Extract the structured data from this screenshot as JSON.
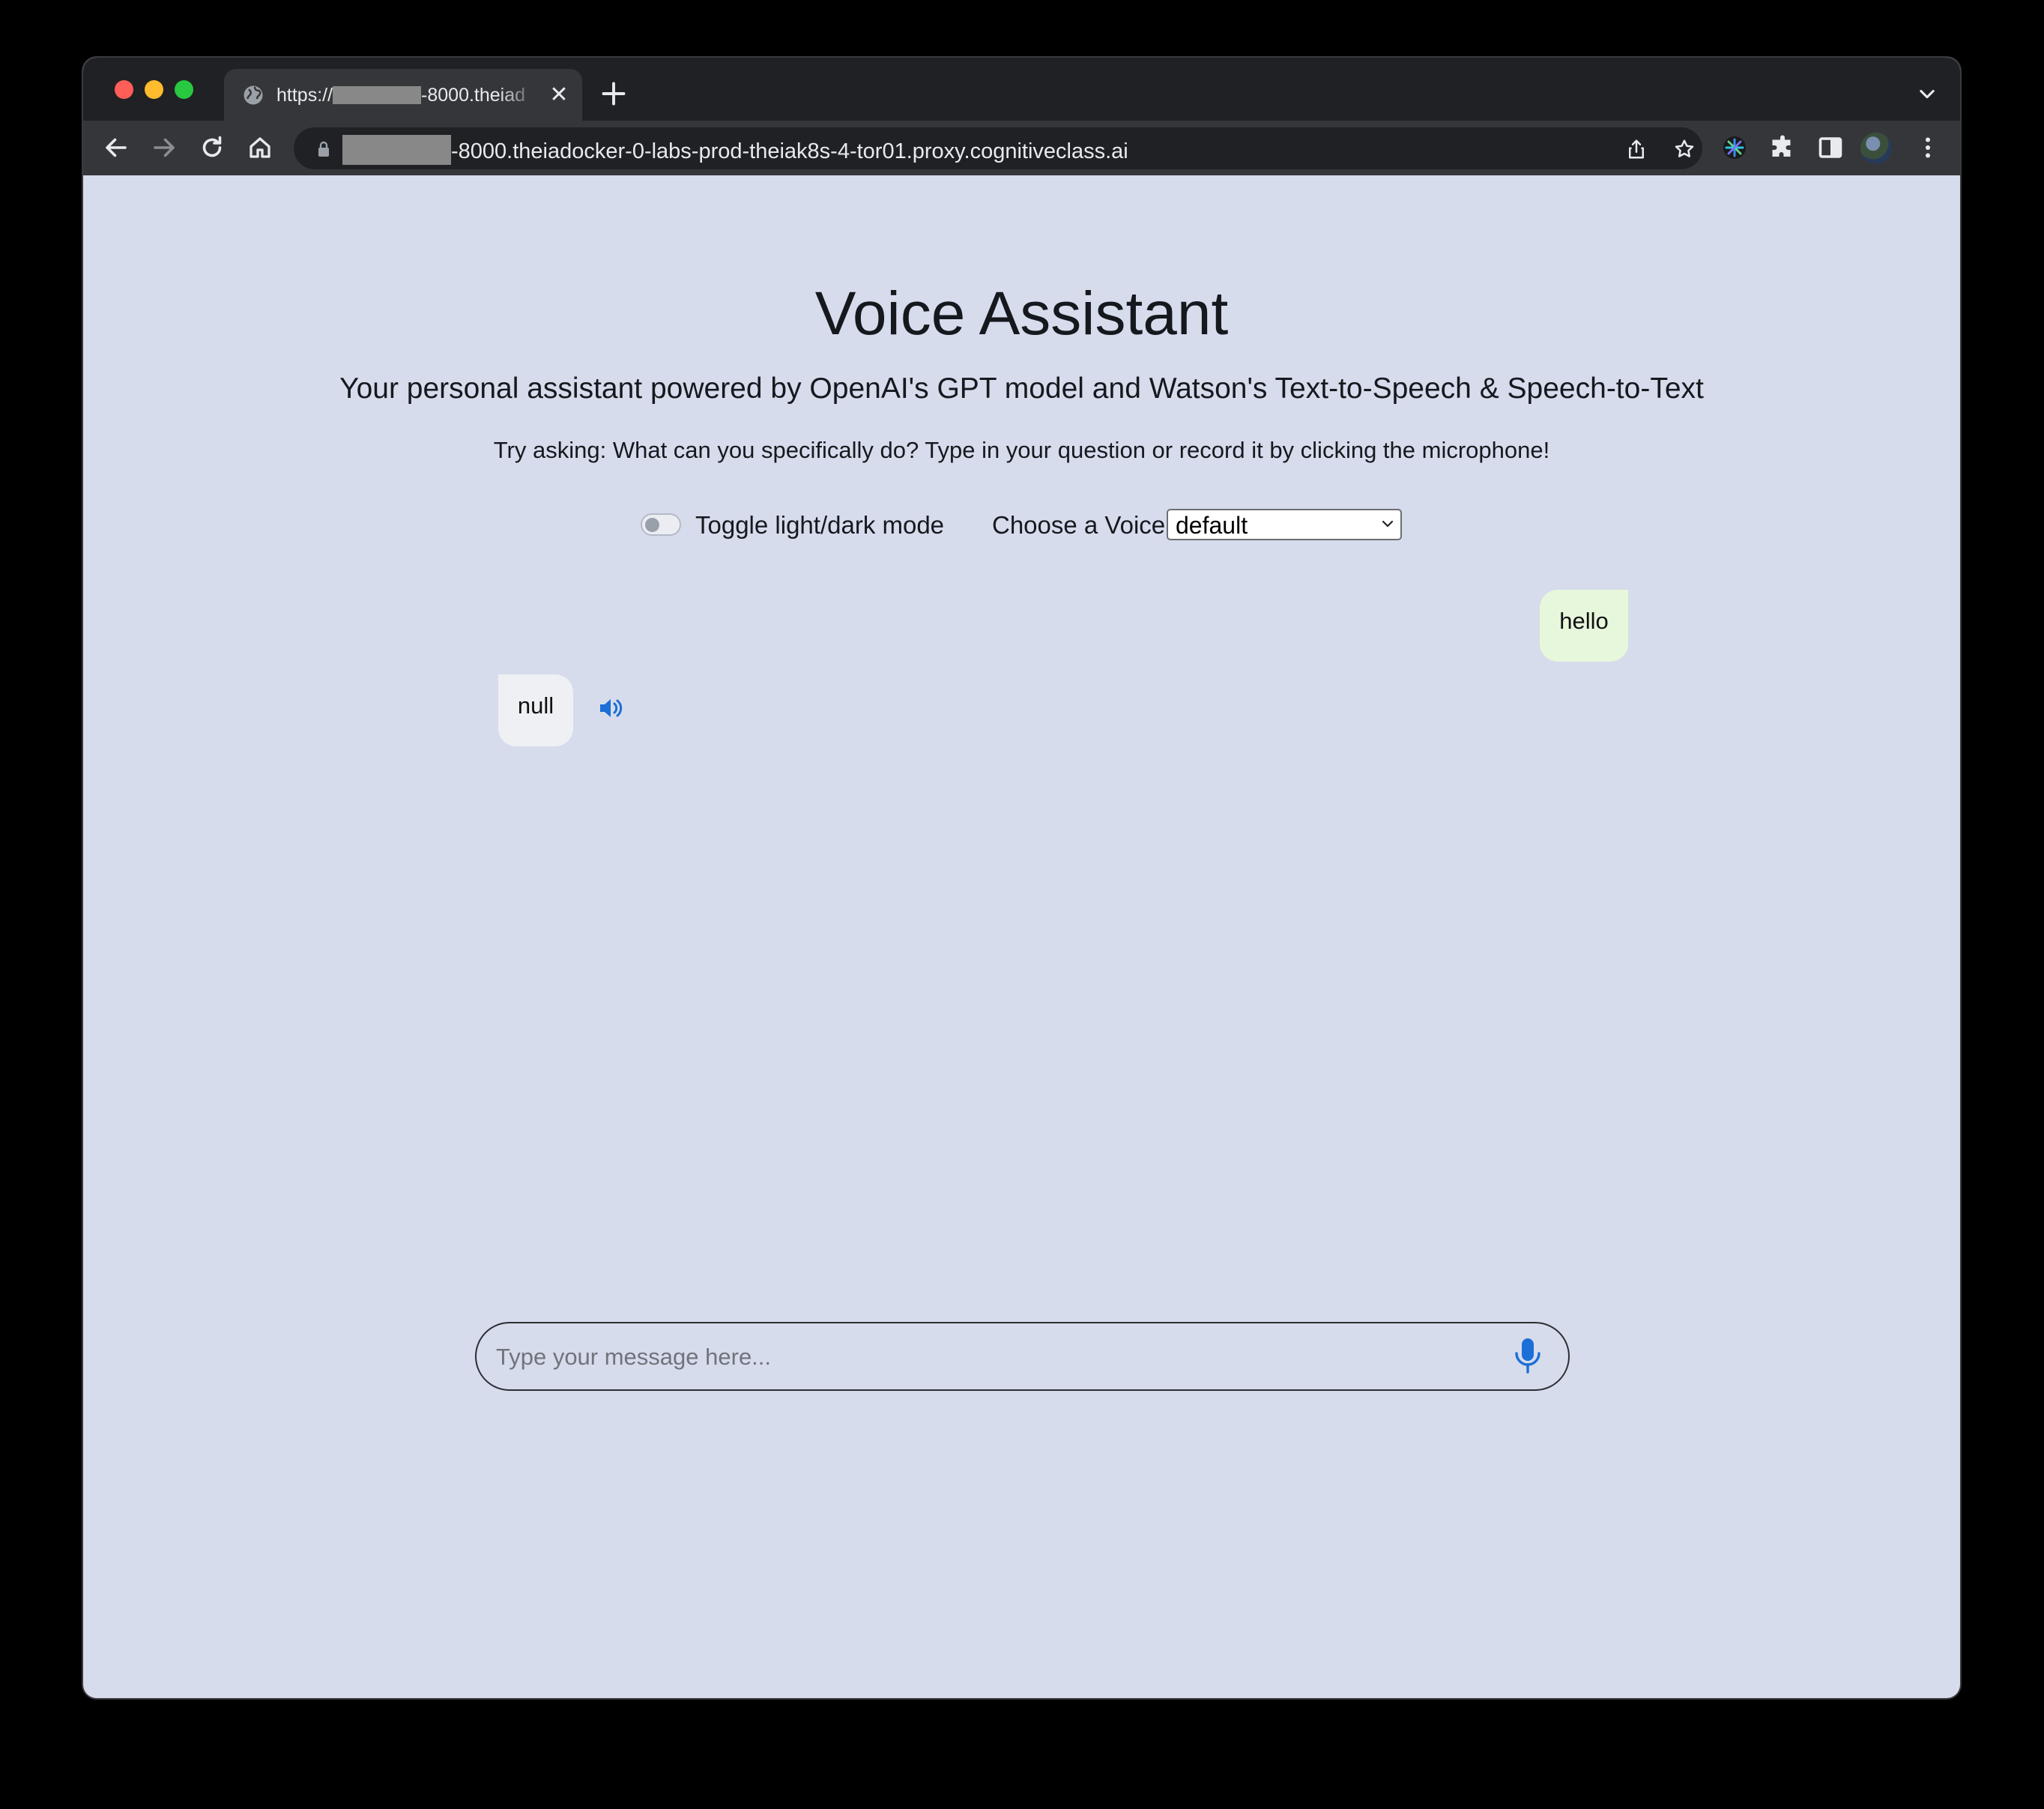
{
  "browser": {
    "tab": {
      "title_prefix": "https://",
      "title_suffix": "-8000.theiad",
      "close_glyph": "✕"
    },
    "url_suffix": "-8000.theiadocker-0-labs-prod-theiak8s-4-tor01.proxy.cognitiveclass.ai",
    "icons": [
      "back-icon",
      "forward-icon",
      "reload-icon",
      "home-icon",
      "lock-icon",
      "share-icon",
      "star-icon",
      "extension-icon",
      "puzzle-icon",
      "side-panel-icon",
      "avatar",
      "menu-icon"
    ]
  },
  "page": {
    "title": "Voice Assistant",
    "subtitle": "Your personal assistant powered by OpenAI's GPT model and Watson's Text-to-Speech & Speech-to-Text",
    "hint": "Try asking: What can you specifically do? Type in your question or record it by clicking the microphone!",
    "toggle_label": "Toggle light/dark mode",
    "voice_label": "Choose a Voice",
    "voice_selected": "default",
    "toggle_on": false
  },
  "chat": {
    "messages": [
      {
        "role": "user",
        "text": "hello"
      },
      {
        "role": "assistant",
        "text": "null"
      }
    ]
  },
  "input": {
    "placeholder": "Type your message here...",
    "value": ""
  },
  "colors": {
    "page_bg": "#d6dcec",
    "user_bubble": "#e6f7dc",
    "bot_bubble": "#eef0f4",
    "accent": "#1b6fd6"
  }
}
